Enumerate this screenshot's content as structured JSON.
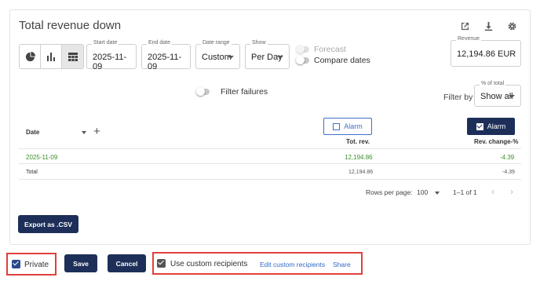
{
  "widget": {
    "title": "Total revenue down",
    "icons": [
      "open-external-icon",
      "download-icon",
      "settings-gear-icon"
    ],
    "view_modes": [
      "pie-chart-icon",
      "bar-chart-icon",
      "table-icon"
    ],
    "active_view": "table-icon"
  },
  "filters": {
    "start_date": {
      "label": "Start date",
      "value": "2025-11-09"
    },
    "end_date": {
      "label": "End date",
      "value": "2025-11-09"
    },
    "date_range": {
      "label": "Date range",
      "value": "Custom"
    },
    "show": {
      "label": "Show",
      "value": "Per Day"
    },
    "forecast": {
      "label": "Forecast",
      "enabled": false
    },
    "compare_dates": {
      "label": "Compare dates",
      "enabled": false
    },
    "revenue": {
      "label": "Revenue",
      "value": "12,194.86 EUR"
    },
    "filter_failures": {
      "label": "Filter failures",
      "enabled": false
    },
    "filter_by": {
      "label": "Filter by",
      "field_label": "% of total",
      "value": "Show all"
    }
  },
  "table": {
    "alarm_labels": [
      "Alarm",
      "Alarm"
    ],
    "columns": [
      "Date",
      "Tot. rev.",
      "Rev. change-%"
    ],
    "rows": [
      {
        "date": "2025-11-09",
        "tot_rev": "12,194.86",
        "rev_change": "-4.39"
      }
    ],
    "total": {
      "label": "Total",
      "tot_rev": "12,194.86",
      "rev_change": "-4.39"
    },
    "pagination": {
      "rows_per_page_label": "Rows per page:",
      "rows_per_page": "100",
      "range": "1–1 of 1"
    }
  },
  "actions": {
    "export_label": "Export as .CSV",
    "private_label": "Private",
    "save_label": "Save",
    "cancel_label": "Cancel",
    "custom_recipients_label": "Use custom recipients",
    "edit_recipients_label": "Edit custom recipients",
    "share_label": "Share"
  },
  "colors": {
    "primary_dark": "#1d2f59",
    "link_blue": "#2f6ac4",
    "positive_green": "#3a8f2a",
    "highlight_red": "#e0403a"
  }
}
